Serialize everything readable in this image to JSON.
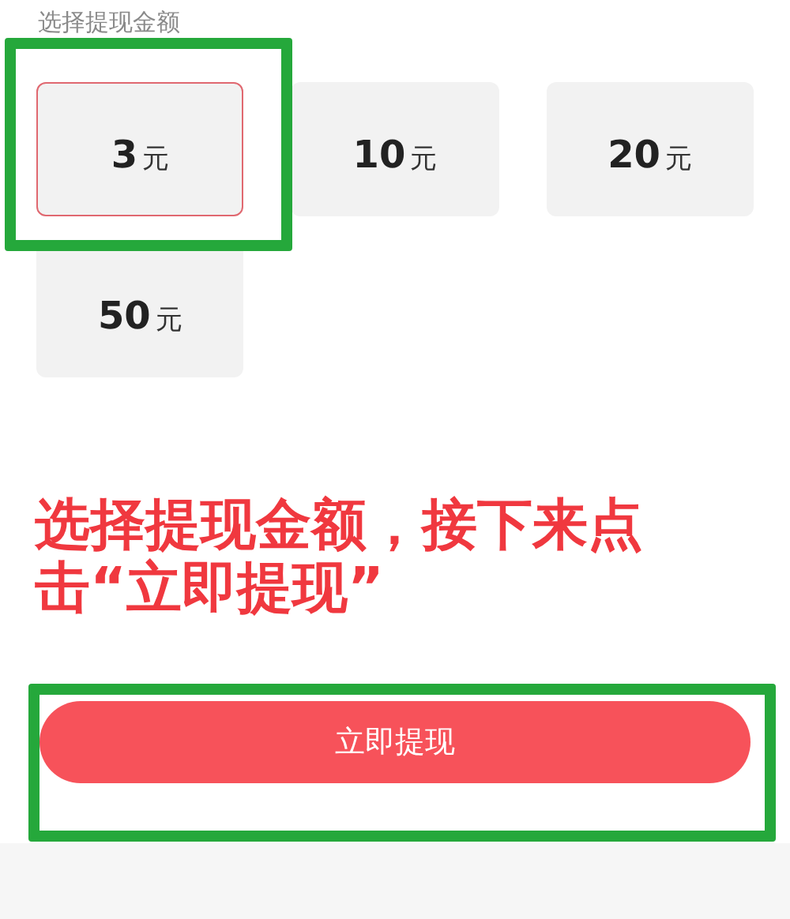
{
  "section_title": "选择提现金额",
  "amounts": [
    {
      "amount": "3",
      "unit": "元",
      "selected": true
    },
    {
      "amount": "10",
      "unit": "元",
      "selected": false
    },
    {
      "amount": "20",
      "unit": "元",
      "selected": false
    },
    {
      "amount": "50",
      "unit": "元",
      "selected": false
    }
  ],
  "annotation": "选择提现金额，接下来点击“立即提现”",
  "withdraw_button": "立即提现"
}
